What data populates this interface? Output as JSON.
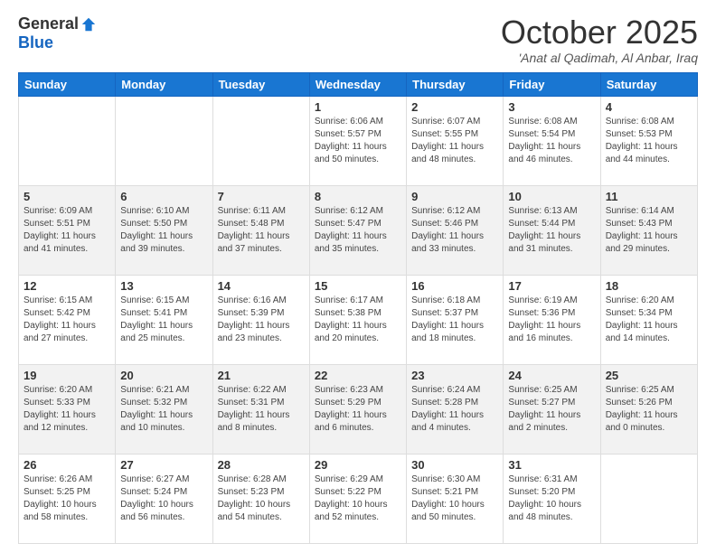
{
  "header": {
    "logo_general": "General",
    "logo_blue": "Blue",
    "month_title": "October 2025",
    "location": "'Anat al Qadimah, Al Anbar, Iraq"
  },
  "days_of_week": [
    "Sunday",
    "Monday",
    "Tuesday",
    "Wednesday",
    "Thursday",
    "Friday",
    "Saturday"
  ],
  "weeks": [
    [
      {
        "num": "",
        "info": ""
      },
      {
        "num": "",
        "info": ""
      },
      {
        "num": "",
        "info": ""
      },
      {
        "num": "1",
        "info": "Sunrise: 6:06 AM\nSunset: 5:57 PM\nDaylight: 11 hours and 50 minutes."
      },
      {
        "num": "2",
        "info": "Sunrise: 6:07 AM\nSunset: 5:55 PM\nDaylight: 11 hours and 48 minutes."
      },
      {
        "num": "3",
        "info": "Sunrise: 6:08 AM\nSunset: 5:54 PM\nDaylight: 11 hours and 46 minutes."
      },
      {
        "num": "4",
        "info": "Sunrise: 6:08 AM\nSunset: 5:53 PM\nDaylight: 11 hours and 44 minutes."
      }
    ],
    [
      {
        "num": "5",
        "info": "Sunrise: 6:09 AM\nSunset: 5:51 PM\nDaylight: 11 hours and 41 minutes."
      },
      {
        "num": "6",
        "info": "Sunrise: 6:10 AM\nSunset: 5:50 PM\nDaylight: 11 hours and 39 minutes."
      },
      {
        "num": "7",
        "info": "Sunrise: 6:11 AM\nSunset: 5:48 PM\nDaylight: 11 hours and 37 minutes."
      },
      {
        "num": "8",
        "info": "Sunrise: 6:12 AM\nSunset: 5:47 PM\nDaylight: 11 hours and 35 minutes."
      },
      {
        "num": "9",
        "info": "Sunrise: 6:12 AM\nSunset: 5:46 PM\nDaylight: 11 hours and 33 minutes."
      },
      {
        "num": "10",
        "info": "Sunrise: 6:13 AM\nSunset: 5:44 PM\nDaylight: 11 hours and 31 minutes."
      },
      {
        "num": "11",
        "info": "Sunrise: 6:14 AM\nSunset: 5:43 PM\nDaylight: 11 hours and 29 minutes."
      }
    ],
    [
      {
        "num": "12",
        "info": "Sunrise: 6:15 AM\nSunset: 5:42 PM\nDaylight: 11 hours and 27 minutes."
      },
      {
        "num": "13",
        "info": "Sunrise: 6:15 AM\nSunset: 5:41 PM\nDaylight: 11 hours and 25 minutes."
      },
      {
        "num": "14",
        "info": "Sunrise: 6:16 AM\nSunset: 5:39 PM\nDaylight: 11 hours and 23 minutes."
      },
      {
        "num": "15",
        "info": "Sunrise: 6:17 AM\nSunset: 5:38 PM\nDaylight: 11 hours and 20 minutes."
      },
      {
        "num": "16",
        "info": "Sunrise: 6:18 AM\nSunset: 5:37 PM\nDaylight: 11 hours and 18 minutes."
      },
      {
        "num": "17",
        "info": "Sunrise: 6:19 AM\nSunset: 5:36 PM\nDaylight: 11 hours and 16 minutes."
      },
      {
        "num": "18",
        "info": "Sunrise: 6:20 AM\nSunset: 5:34 PM\nDaylight: 11 hours and 14 minutes."
      }
    ],
    [
      {
        "num": "19",
        "info": "Sunrise: 6:20 AM\nSunset: 5:33 PM\nDaylight: 11 hours and 12 minutes."
      },
      {
        "num": "20",
        "info": "Sunrise: 6:21 AM\nSunset: 5:32 PM\nDaylight: 11 hours and 10 minutes."
      },
      {
        "num": "21",
        "info": "Sunrise: 6:22 AM\nSunset: 5:31 PM\nDaylight: 11 hours and 8 minutes."
      },
      {
        "num": "22",
        "info": "Sunrise: 6:23 AM\nSunset: 5:29 PM\nDaylight: 11 hours and 6 minutes."
      },
      {
        "num": "23",
        "info": "Sunrise: 6:24 AM\nSunset: 5:28 PM\nDaylight: 11 hours and 4 minutes."
      },
      {
        "num": "24",
        "info": "Sunrise: 6:25 AM\nSunset: 5:27 PM\nDaylight: 11 hours and 2 minutes."
      },
      {
        "num": "25",
        "info": "Sunrise: 6:25 AM\nSunset: 5:26 PM\nDaylight: 11 hours and 0 minutes."
      }
    ],
    [
      {
        "num": "26",
        "info": "Sunrise: 6:26 AM\nSunset: 5:25 PM\nDaylight: 10 hours and 58 minutes."
      },
      {
        "num": "27",
        "info": "Sunrise: 6:27 AM\nSunset: 5:24 PM\nDaylight: 10 hours and 56 minutes."
      },
      {
        "num": "28",
        "info": "Sunrise: 6:28 AM\nSunset: 5:23 PM\nDaylight: 10 hours and 54 minutes."
      },
      {
        "num": "29",
        "info": "Sunrise: 6:29 AM\nSunset: 5:22 PM\nDaylight: 10 hours and 52 minutes."
      },
      {
        "num": "30",
        "info": "Sunrise: 6:30 AM\nSunset: 5:21 PM\nDaylight: 10 hours and 50 minutes."
      },
      {
        "num": "31",
        "info": "Sunrise: 6:31 AM\nSunset: 5:20 PM\nDaylight: 10 hours and 48 minutes."
      },
      {
        "num": "",
        "info": ""
      }
    ]
  ]
}
